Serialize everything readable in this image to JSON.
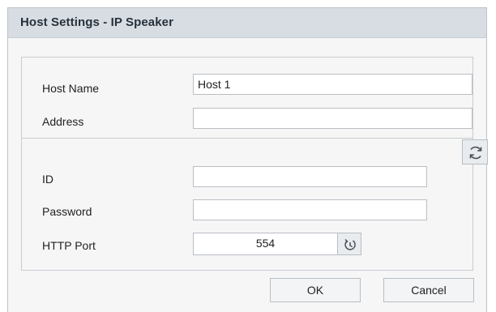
{
  "dialog": {
    "title": "Host Settings - IP Speaker"
  },
  "host": {
    "name_label": "Host Name",
    "name_value": "Host 1",
    "address_label": "Address",
    "address_value": ""
  },
  "auth": {
    "refresh_icon": "refresh-icon",
    "id_label": "ID",
    "id_value": "",
    "password_label": "Password",
    "password_value": "",
    "port_label": "HTTP Port",
    "port_value": "554",
    "port_reset_icon": "reset-default-icon"
  },
  "footer": {
    "ok_label": "OK",
    "cancel_label": "Cancel"
  }
}
